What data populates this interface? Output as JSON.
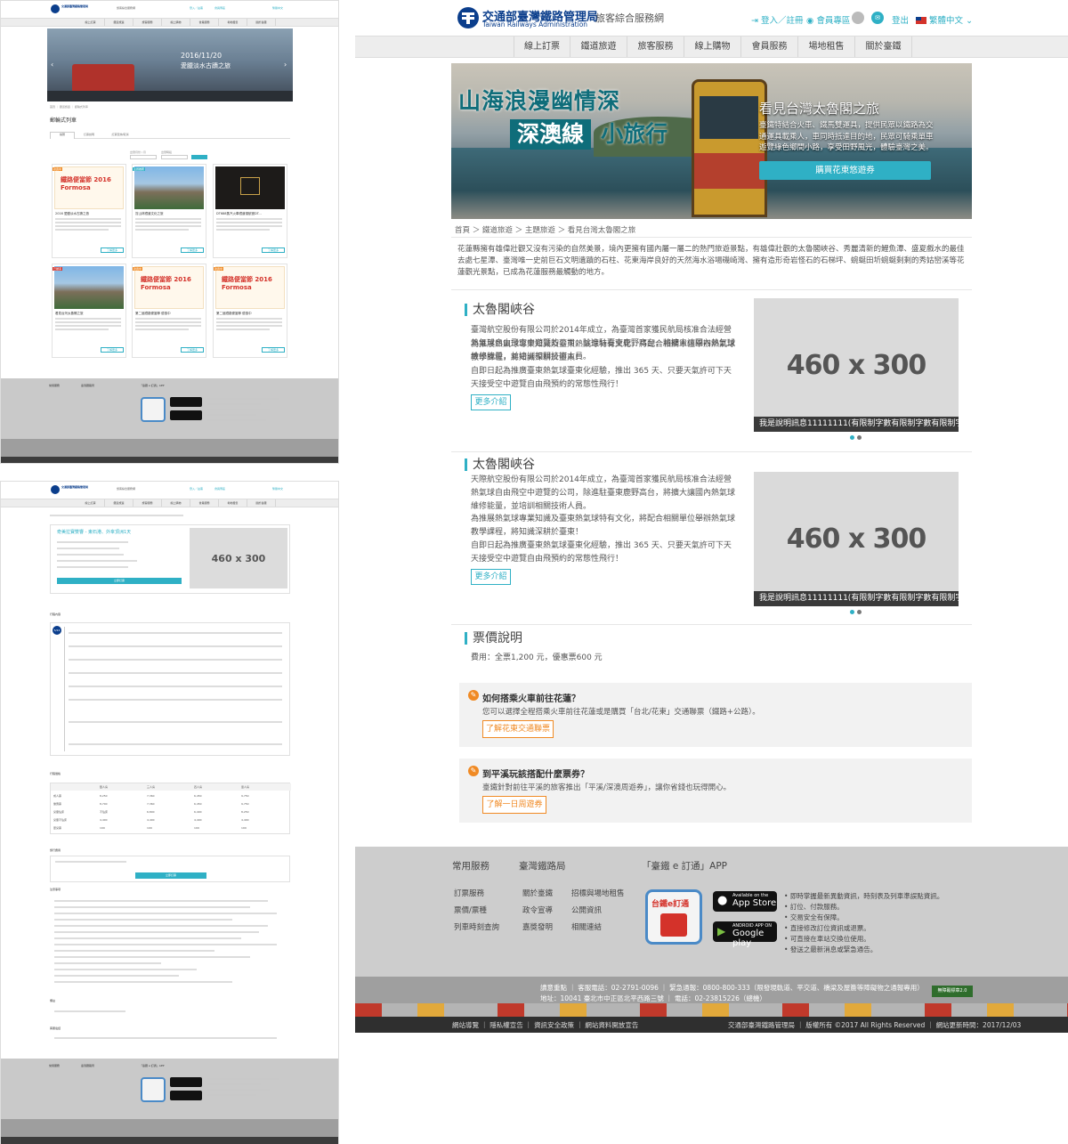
{
  "brand": {
    "name_zh": "交通部臺灣鐵路管理局",
    "name_en": "Taiwan Railways Administration",
    "subtitle": "旅客綜合服務網"
  },
  "header": {
    "login": "登入／註冊",
    "member": "會員專區",
    "logout": "登出",
    "language": "繁體中文"
  },
  "nav": [
    "線上訂票",
    "鐵道旅遊",
    "旅客服務",
    "線上購物",
    "會員服務",
    "場地租售",
    "關於臺鐵"
  ],
  "hero": {
    "headline1": "山海浪漫幽情深",
    "headline2a": "深澳線",
    "headline2b": "小旅行",
    "right_title": "看見台灣太魯閣之旅",
    "right_text": "臺鐵特結合火車、鐵馬雙運具，提供民眾以鐵路為交通運具載乘人，車同時抵達目的地，民眾可騎乘單車遊覽綠色鄉間小路，享受田野風光，體驗臺灣之美。",
    "cta": "購買花東悠遊券"
  },
  "breadcrumb": [
    "首頁",
    "鐵道旅遊",
    "主題旅遊",
    "看見台灣太魯閣之旅"
  ],
  "intro": "花蓮縣擁有雄偉壯觀又沒有污染的自然美景，境內更擁有國內屬一屬二的熱門旅遊景點，有雄偉壯觀的太魯閣峽谷、秀麗清新的鯉魚潭、盛夏戲水的最佳去處七星潭、臺灣唯一史前巨石文明遺蹟的石柱、花東海岸良好的天然海水浴場磯崎灣、擁有造形奇岩怪石的石梯坪、蜿蜒田圻蜿蜒剩剩的秀姑巒溪等花蓮觀光景點，已成為花蓮服務最觸動的地方。",
  "sections": [
    {
      "title": "太魯閣峽谷",
      "paras": [
        "臺灣航空股份有限公司於2014年成立，為臺灣首家獲民航局核准合法經營熱氣球自由飛空中遊覽的公司，除進駐臺東鹿野高台，將擴大讓國內熱氣球維修能量，並培訓相關技術人員。",
        "為推展熱氣球專業知識及臺東熱氣球特有文化，將配合相關單位舉辦熱氣球教學課程，將知識深耕於臺東！",
        "自即日起為推廣臺東熱氣球臺東化經驗，推出 365 天、只要天氣許可下天天接受空中遊覽自由飛預約的常態性飛行！"
      ],
      "more": "更多介紹",
      "image_label": "460 x 300",
      "caption": "我是說明訊息11111111(有限制字數有限制字數有限制字數..."
    },
    {
      "title": "太魯閣峽谷",
      "paras": [
        "天際航空股份有限公司於2014年成立，為臺灣首家獲民航局核准合法經營熱氣球自由飛空中遊覽的公司，除進駐臺東鹿野高台，將擴大讓國內熱氣球維修能量，並培訓相關技術人員。",
        "為推展熱氣球專業知識及臺東熱氣球特有文化，將配合相關單位舉辦熱氣球教學課程，將知識深耕於臺東！",
        "自即日起為推廣臺東熱氣球臺東化經驗，推出 365 天、只要天氣許可下天天接受空中遊覽自由飛預約的常態性飛行！"
      ],
      "more": "更多介紹",
      "image_label": "460 x 300",
      "caption": "我是說明訊息11111111(有限制字數有限制字數有限制字數..."
    }
  ],
  "ticket": {
    "title": "票價說明",
    "text": "費用：全票1,200 元，優惠票600 元"
  },
  "faq": [
    {
      "q": "如何搭乘火車前往花蓮？",
      "a": "您可以選擇全程搭乘火車前往花蓮或是購買「台北/花東」交通聯票（鐵路+公路）。",
      "btn": "了解花東交通聯票"
    },
    {
      "q": "到平溪玩該搭配什麼票券？",
      "a": "臺鐵針對前往平溪的旅客推出「平溪/深澳周遊券」，讓你省錢也玩得開心。",
      "btn": "了解一日周遊券"
    }
  ],
  "footer": {
    "col1_title": "常用服務",
    "col1": [
      "訂票服務",
      "票價/票種",
      "列車時刻查詢"
    ],
    "col2_title": "臺灣鐵路局",
    "col2a": [
      "關於臺鐵",
      "政令宣導",
      "嘉獎發明"
    ],
    "col2b": [
      "招標與場地租售",
      "公開資訊",
      "相關連結"
    ],
    "app_title": "「臺鐵 e 訂通」APP",
    "app_store": "App Store",
    "app_store_top": "Available on the",
    "google_play": "Google play",
    "google_play_top": "ANDROID APP ON",
    "app_icon_text": "台鐵e訂通",
    "app_features": [
      "即時掌握最新異動資訊，時刻表及列車準誤點資訊。",
      "訂位、付款服務。",
      "交易安全有保障。",
      "直接修改訂位資訊或退票。",
      "可直接在車站交換位使用。",
      "發送之最新消息或緊急通告。"
    ],
    "contact_line1": "讀意重點 ｜ 客服電話：02-2791-0096 ｜ 緊急通報：0800-800-333（限發現軌道、平交道、橋梁及屋簷等障礙物之通報專用）",
    "contact_line2": "地址：10041 臺北市中正區北平西路三號 ｜ 電話：02-23815226（總機）",
    "badge": "無障礙標章2.0",
    "links": [
      "網站導覽",
      "隱私權宣告",
      "資訊安全政策",
      "網站資料開放宣告"
    ],
    "org": "交通部臺灣鐵路管理局",
    "copyright": "版權所有 ©2017 All Rights Reserved",
    "updated": "網站更新時間：2017/12/03"
  },
  "thumb1": {
    "banner_date": "2016/11/20",
    "banner_title": "愛臘淡水古蹟之旅",
    "page_title": "郵輪式列車",
    "tabs": [
      "總覽",
      "訂票說明",
      "訂票查詢/取消"
    ],
    "filter_labels": [
      "出發月份 / 月",
      "出發時段"
    ],
    "cards": [
      {
        "tag": "熱賣中",
        "poster": "鐵路便當節 2016 Formosa",
        "title": "2016 愛臘淡水古蹟之旅",
        "btn": "了解更多"
      },
      {
        "tag": "主題推薦",
        "poster": "",
        "title": "賞山林鐵道文化之旅",
        "btn": "了解更多"
      },
      {
        "tag": "",
        "poster": "",
        "title": "DT688蒸汽火車鐵道領航號DT...",
        "btn": "了解更多"
      },
      {
        "tag": "已額滿",
        "poster": "",
        "title": "看見台灣太魯閣之旅",
        "btn": "了解更多"
      },
      {
        "tag": "熱賣中",
        "poster": "鐵路便當節 2016 Formosa",
        "title": "第二屆鐵路便當節 優惠中",
        "btn": "了解更多"
      },
      {
        "tag": "熱賣中",
        "poster": "鐵路便當節 2016 Formosa",
        "title": "第二屆鐵路便當節 優惠中",
        "btn": "了解更多"
      }
    ]
  },
  "thumb2": {
    "product_title": "奇美拉寶雙響 - 東石港、外傘頂洲1天",
    "image_label": "460 x 300",
    "book_btn": "立即訂票",
    "day_tag": "5/24",
    "sections": [
      "行程內容",
      "行程價格",
      "旅行費用",
      "注意事項",
      "備註",
      "客服電話"
    ],
    "price_headers": [
      "",
      "雙人房",
      "三人房",
      "四人房",
      "單人房"
    ],
    "price_rows": [
      [
        "成人票",
        "8,250",
        "7,360",
        "6,450",
        "9,750"
      ],
      [
        "優惠票",
        "8,700",
        "7,360",
        "6,450",
        "9,750"
      ],
      [
        "兒童佔床",
        "不佔床",
        "6,800",
        "6,400",
        "8,250"
      ],
      [
        "兒童不佔床",
        "4,400",
        "4,400",
        "4,400",
        "4,400"
      ],
      [
        "嬰兒票",
        "199",
        "199",
        "199",
        "199"
      ]
    ]
  },
  "colors": {
    "accent": "#2fb0c5",
    "orange": "#f08a24",
    "navy": "#0b3e8c"
  }
}
